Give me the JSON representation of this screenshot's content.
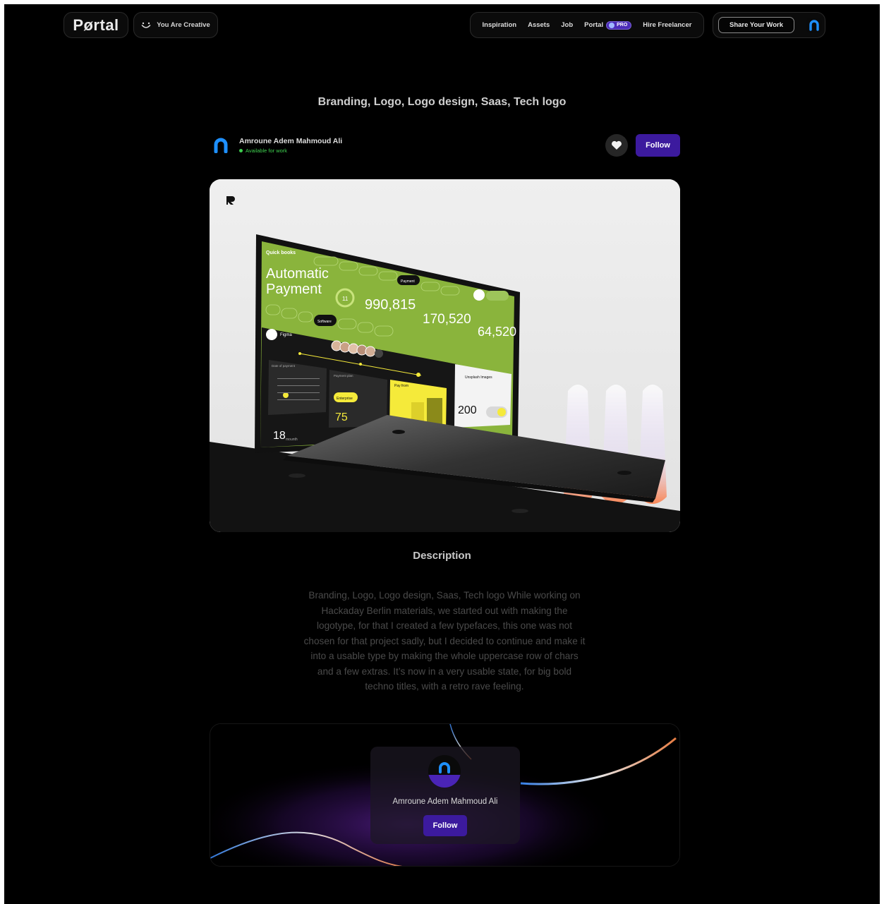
{
  "header": {
    "logo": "Pørtal",
    "tagline": "You Are Creative",
    "nav": [
      "Inspiration",
      "Assets",
      "Job",
      "Portal",
      "Hire Freelancer"
    ],
    "pro_badge": "PRO",
    "share_label": "Share Your Work"
  },
  "shot": {
    "title": "Branding, Logo, Logo design, Saas, Tech logo",
    "like_icon": "heart-icon",
    "follow_label": "Follow"
  },
  "author": {
    "name": "Amroune Adem Mahmoud Ali",
    "status": "Available for work",
    "status_color": "#3ecf4f"
  },
  "mockup": {
    "brand": "Quick books",
    "headline_1": "Automatic",
    "headline_2": "Payment",
    "badge_value": "11",
    "stat_1": "990,815",
    "stat_2": "170,520",
    "stat_3": "64,520",
    "chip_active": "Software",
    "tab_active": "Payment",
    "app_name": "Figma",
    "calendar_title": "Date of payment",
    "calendar_value": "18",
    "calendar_unit": "mounth",
    "plan_title": "Payment plan",
    "plan_active": "Enterprise",
    "plan_value": "75",
    "pay_title": "Pay from",
    "side_title": "Unsplash Images",
    "side_value": "200",
    "accent": "#8ab43c",
    "highlight": "#f5ea3a"
  },
  "description": {
    "heading": "Description",
    "body": "Branding, Logo, Logo design, Saas, Tech logo While working on Hackaday Berlin materials, we started out with making the logotype, for that I created a few typefaces, this one was not chosen for that project sadly, but I decided to continue and make it into a usable type by making the whole uppercase row of chars and a few extras. It’s now in a very usable state, for big bold techno titles, with a retro rave feeling."
  },
  "creator_card": {
    "name": "Amroune Adem Mahmoud Ali",
    "follow_label": "Follow"
  },
  "colors": {
    "background": "#000000",
    "primary_button": "#3c1a9e",
    "brand_blue": "#1e90ff"
  }
}
